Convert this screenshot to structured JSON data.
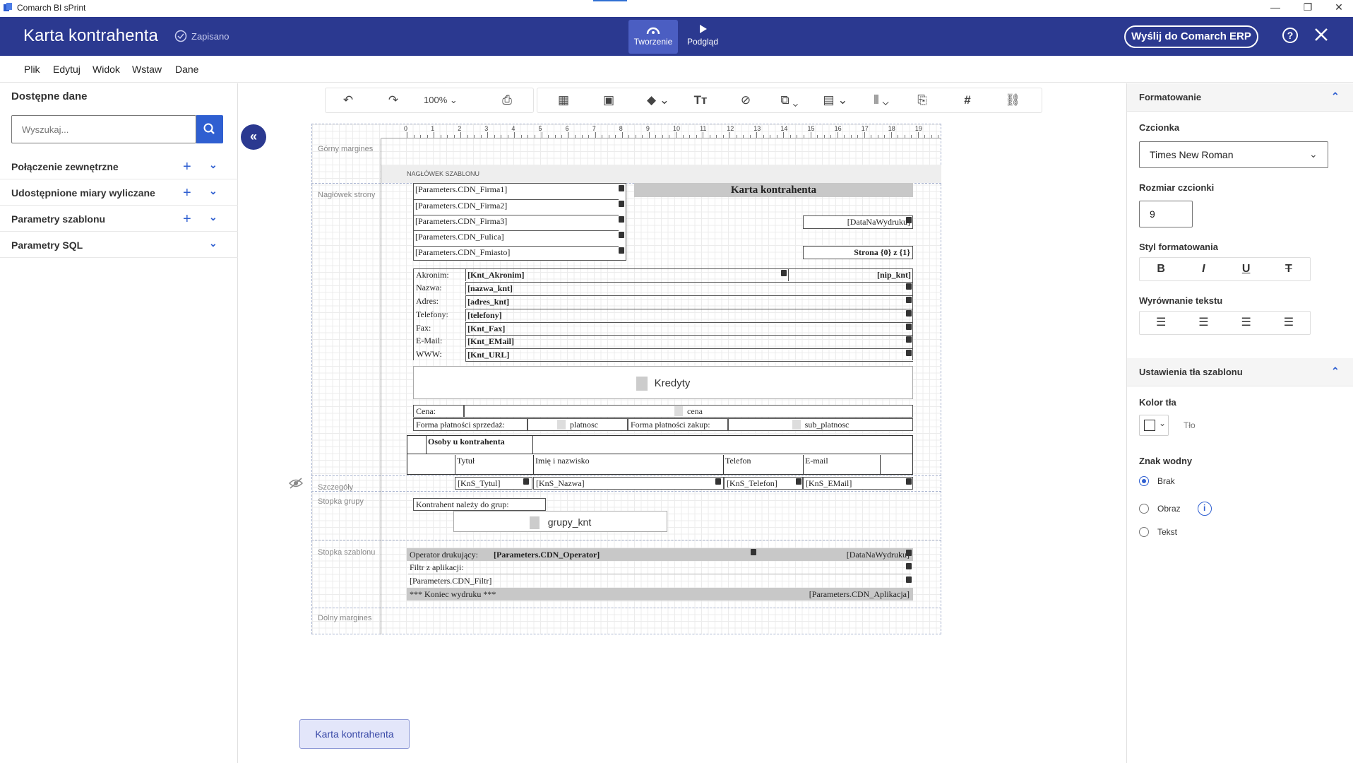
{
  "window": {
    "app_title": "Comarch BI sPrint",
    "minimize": "—",
    "restore": "❐",
    "close": "✕"
  },
  "header": {
    "title": "Karta kontrahenta",
    "saved": "Zapisano",
    "mode_create": "Tworzenie",
    "mode_preview": "Podgląd",
    "send": "Wyślij do Comarch ERP"
  },
  "menu": [
    "Plik",
    "Edytuj",
    "Widok",
    "Wstaw",
    "Dane"
  ],
  "left": {
    "title": "Dostępne dane",
    "search_placeholder": "Wyszukaj...",
    "sections": [
      "Połączenie zewnętrzne",
      "Udostępnione miary wyliczane",
      "Parametry szablonu",
      "Parametry SQL"
    ]
  },
  "toolbar": {
    "zoom": "100%"
  },
  "ruler": [
    "0",
    "1",
    "2",
    "3",
    "4",
    "5",
    "6",
    "7",
    "8",
    "9",
    "10",
    "11",
    "12",
    "13",
    "14",
    "15",
    "16",
    "17",
    "18",
    "19"
  ],
  "bands": {
    "top_margin": "Górny margines",
    "template_header": "NAGŁÓWEK SZABLONU",
    "page_header": "Nagłówek strony",
    "details": "Szczegóły",
    "group_footer": "Stopka grupy",
    "template_footer": "Stopka szablonu",
    "bottom_margin": "Dolny margines"
  },
  "report": {
    "firm_fields": [
      "[Parameters.CDN_Firma1]",
      "[Parameters.CDN_Firma2]",
      "[Parameters.CDN_Firma3]",
      "[Parameters.CDN_Fulica]",
      "[Parameters.CDN_Fmiasto]"
    ],
    "title": "Karta kontrahenta",
    "print_date": "[DataNaWydruku]",
    "page_num": "Strona {0} z {1}",
    "rows": [
      {
        "label": "Akronim:",
        "value": "[Knt_Akronim]"
      },
      {
        "label": "Nazwa:",
        "value": "[nazwa_knt]"
      },
      {
        "label": "Adres:",
        "value": "[adres_knt]"
      },
      {
        "label": "Telefony:",
        "value": "[telefony]"
      },
      {
        "label": "Fax:",
        "value": "[Knt_Fax]"
      },
      {
        "label": "E-Mail:",
        "value": "[Knt_EMail]"
      },
      {
        "label": "WWW:",
        "value": "[Knt_URL]"
      }
    ],
    "nip": "[nip_knt]",
    "credits": "Kredyty",
    "price_label": "Cena:",
    "price_value": "cena",
    "pay_sale_label": "Forma płatności sprzedaż:",
    "pay_sale_value": "platnosc",
    "pay_buy_label": "Forma płatności zakup:",
    "pay_buy_value": "sub_platnosc",
    "persons_title": "Osoby u kontrahenta",
    "persons_cols": [
      "Tytuł",
      "Imię i nazwisko",
      "Telefon",
      "E-mail"
    ],
    "detail_fields": [
      "[KnS_Tytul]",
      "[KnS_Nazwa]",
      "[KnS_Telefon]",
      "[KnS_EMail]"
    ],
    "group_label": "Kontrahent należy do grup:",
    "group_value": "grupy_knt",
    "operator_label": "Operator drukujący:",
    "operator_value": "[Parameters.CDN_Operator]",
    "filter_label": "Filtr z aplikacji:",
    "filter_value": "[Parameters.CDN_Filtr]",
    "end_label": "*** Koniec wydruku ***",
    "app_value": "[Parameters.CDN_Aplikacja]"
  },
  "right": {
    "format_title": "Formatowanie",
    "font_label": "Czcionka",
    "font_value": "Times New Roman",
    "size_label": "Rozmiar czcionki",
    "size_value": "9",
    "style_label": "Styl formatowania",
    "align_label": "Wyrównanie tekstu",
    "bg_title": "Ustawienia tła szablonu",
    "bgcolor_label": "Kolor tła",
    "bgcolor_hint": "Tło",
    "watermark_label": "Znak wodny",
    "wm_none": "Brak",
    "wm_image": "Obraz",
    "wm_text": "Tekst"
  },
  "bottom_tab": "Karta kontrahenta"
}
